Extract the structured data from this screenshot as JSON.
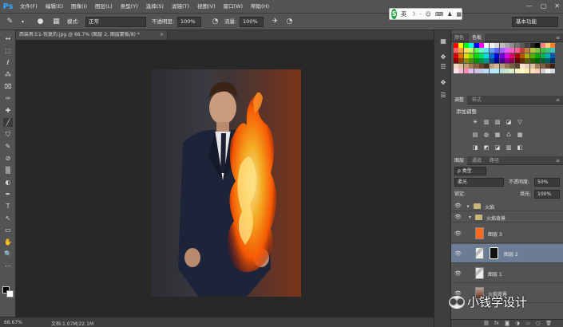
{
  "app": {
    "logo": "Ps"
  },
  "menu": [
    "文件(F)",
    "编辑(E)",
    "图像(I)",
    "图层(L)",
    "类型(Y)",
    "选择(S)",
    "滤镜(T)",
    "视图(V)",
    "窗口(W)",
    "帮助(H)"
  ],
  "window_controls": [
    "—",
    "▢",
    "✕"
  ],
  "options_bar": {
    "mode_label": "模式:",
    "mode_value": "正常",
    "opacity_label": "不透明度:",
    "opacity_value": "100%",
    "flow_label": "流量:",
    "flow_value": "100%",
    "workspace": "基本功能"
  },
  "ime": {
    "logo": "S",
    "lang": "英",
    "icons": [
      "☽",
      "⋅",
      "☺",
      "⌨",
      "♟",
      "▦"
    ]
  },
  "document_tab": {
    "title": "西装男士1-恢复的.jpg @ 66.7% (图层 2, 图层蒙板/8) *",
    "close": "×"
  },
  "tools": [
    "↔",
    "⬚",
    "ℓ",
    "⁂",
    "⌧",
    "✑",
    "✚",
    "╱",
    "⛉",
    "✎",
    "⊘",
    "▒",
    "◐",
    "✒",
    "T",
    "↖",
    "▭",
    "✋",
    "🔍",
    "⋯"
  ],
  "strip_icons": [
    "▦",
    "✥",
    "☰",
    "✥",
    "☰"
  ],
  "panels": {
    "color_tabs": [
      "颜色",
      "色板"
    ],
    "adjust_tabs": [
      "调整",
      "样式"
    ],
    "adjust_title": "添加调整",
    "layers_tabs": [
      "图层",
      "通道",
      "路径"
    ],
    "layers_filter": "ρ 类型",
    "blend_mode": "柔光",
    "opacity_label": "不透明度:",
    "opacity_value": "50%",
    "lock_label": "锁定:",
    "fill_label": "填充:",
    "fill_value": "100%"
  },
  "swatch_colors": [
    "#ff0000",
    "#ffff00",
    "#00ff00",
    "#00ffff",
    "#0000ff",
    "#ff00ff",
    "#ffffff",
    "#f2f2f2",
    "#d9d9d9",
    "#bfbfbf",
    "#a6a6a6",
    "#8c8c8c",
    "#737373",
    "#595959",
    "#404040",
    "#262626",
    "#000000",
    "#ff8080",
    "#ffd080",
    "#ff7f27",
    "#ff6060",
    "#ffa040",
    "#ffe060",
    "#c0ff60",
    "#60ff60",
    "#60ffc0",
    "#60e0ff",
    "#60a0ff",
    "#6060ff",
    "#a060ff",
    "#e060ff",
    "#ff60c0",
    "#ff6090",
    "#c04040",
    "#c08040",
    "#c0c040",
    "#80c040",
    "#40c040",
    "#40c080",
    "#40c0c0",
    "#e00000",
    "#e07000",
    "#e0e000",
    "#70e000",
    "#00e000",
    "#00e070",
    "#00e0e0",
    "#0070e0",
    "#0000e0",
    "#7000e0",
    "#e000e0",
    "#e00070",
    "#b00000",
    "#b05800",
    "#b0b000",
    "#58b000",
    "#00b000",
    "#00b058",
    "#00b0b0",
    "#0058b0",
    "#900000",
    "#904800",
    "#909000",
    "#489000",
    "#009000",
    "#009048",
    "#009090",
    "#004890",
    "#000090",
    "#480090",
    "#900090",
    "#900048",
    "#600000",
    "#603000",
    "#606000",
    "#306000",
    "#006000",
    "#006030",
    "#006060",
    "#003060",
    "#f0d8c0",
    "#e0c0a0",
    "#c8a078",
    "#a87850",
    "#886040",
    "#684828",
    "#483018",
    "#c0a080",
    "#d4b896",
    "#b89878",
    "#987858",
    "#786040",
    "#584830",
    "#f4e4d0",
    "#e8d0b8",
    "#dcc0a0",
    "#a08060",
    "#806040",
    "#604020",
    "#402010",
    "#fce4ec",
    "#f8bbd0",
    "#f48fb1",
    "#e1bee7",
    "#d1c4e9",
    "#c5cae9",
    "#bbdefb",
    "#b3e5fc",
    "#b2ebf2",
    "#b2dfdb",
    "#c8e6c9",
    "#dcedc8",
    "#f0f4c3",
    "#fff9c4",
    "#ffecb3",
    "#ffe0b2",
    "#ffccbc",
    "#d7ccc8",
    "#f5f5f5",
    "#cfd8dc"
  ],
  "adjust_rows": [
    [
      "☀",
      "▥",
      "▨",
      "◪",
      "▽"
    ],
    [
      "▤",
      "◍",
      "▦",
      "♺",
      "▦"
    ],
    [
      "◨",
      "◩",
      "◪",
      "▥",
      "◧"
    ]
  ],
  "layers": [
    {
      "name": "火焰",
      "type": "group",
      "expanded": false
    },
    {
      "name": "火焰背景",
      "type": "group",
      "expanded": true
    },
    {
      "name": "图层 3",
      "type": "layer",
      "selected": false
    },
    {
      "name": "图层 2",
      "type": "layer",
      "selected": true
    },
    {
      "name": "图层 1",
      "type": "layer",
      "selected": false
    },
    {
      "name": "火焰背景",
      "type": "layer",
      "selected": false
    }
  ],
  "layers_footer": [
    "⛓",
    "fx",
    "◙",
    "◑",
    "▭",
    "▢",
    "🗑"
  ],
  "status": {
    "zoom": "66.67%",
    "doc_size": "文档:1.07M/22.1M"
  },
  "watermark": {
    "text": "小钱学设计",
    "icon": "●●"
  }
}
